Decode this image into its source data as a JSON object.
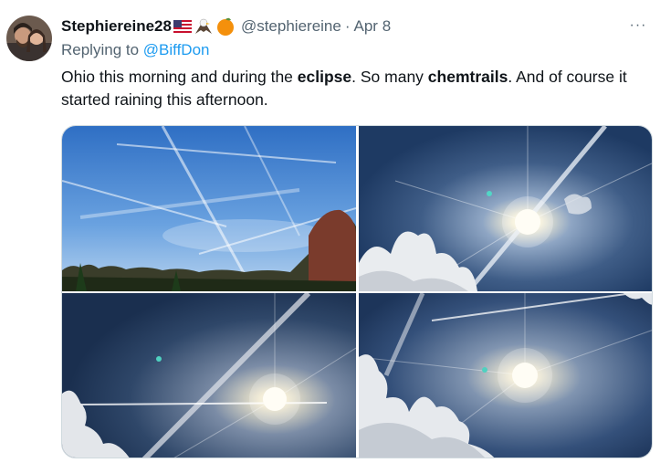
{
  "tweet": {
    "display_name": "Stephiereine28",
    "name_emojis": [
      "us-flag-icon",
      "eagle-icon",
      "orange-icon"
    ],
    "handle": "@stephiereine",
    "separator": "·",
    "date": "Apr 8",
    "more_label": "···",
    "reply_prefix": "Replying to ",
    "reply_to": "@BiffDon",
    "text": {
      "part1": "Ohio this morning and during the ",
      "bold1": "eclipse",
      "part2": ". So many ",
      "bold2": "chemtrails",
      "part3": ". And of course it started raining this afternoon."
    },
    "photos": [
      "blue-sky-trees-photo",
      "sun-contrail-clouds-photo",
      "sun-contrail-photo",
      "sun-contrails-clouds-photo"
    ]
  },
  "colors": {
    "link": "#1d9bf0",
    "secondary_text": "#536471",
    "primary_text": "#0f1419",
    "border": "#cfd9de"
  }
}
